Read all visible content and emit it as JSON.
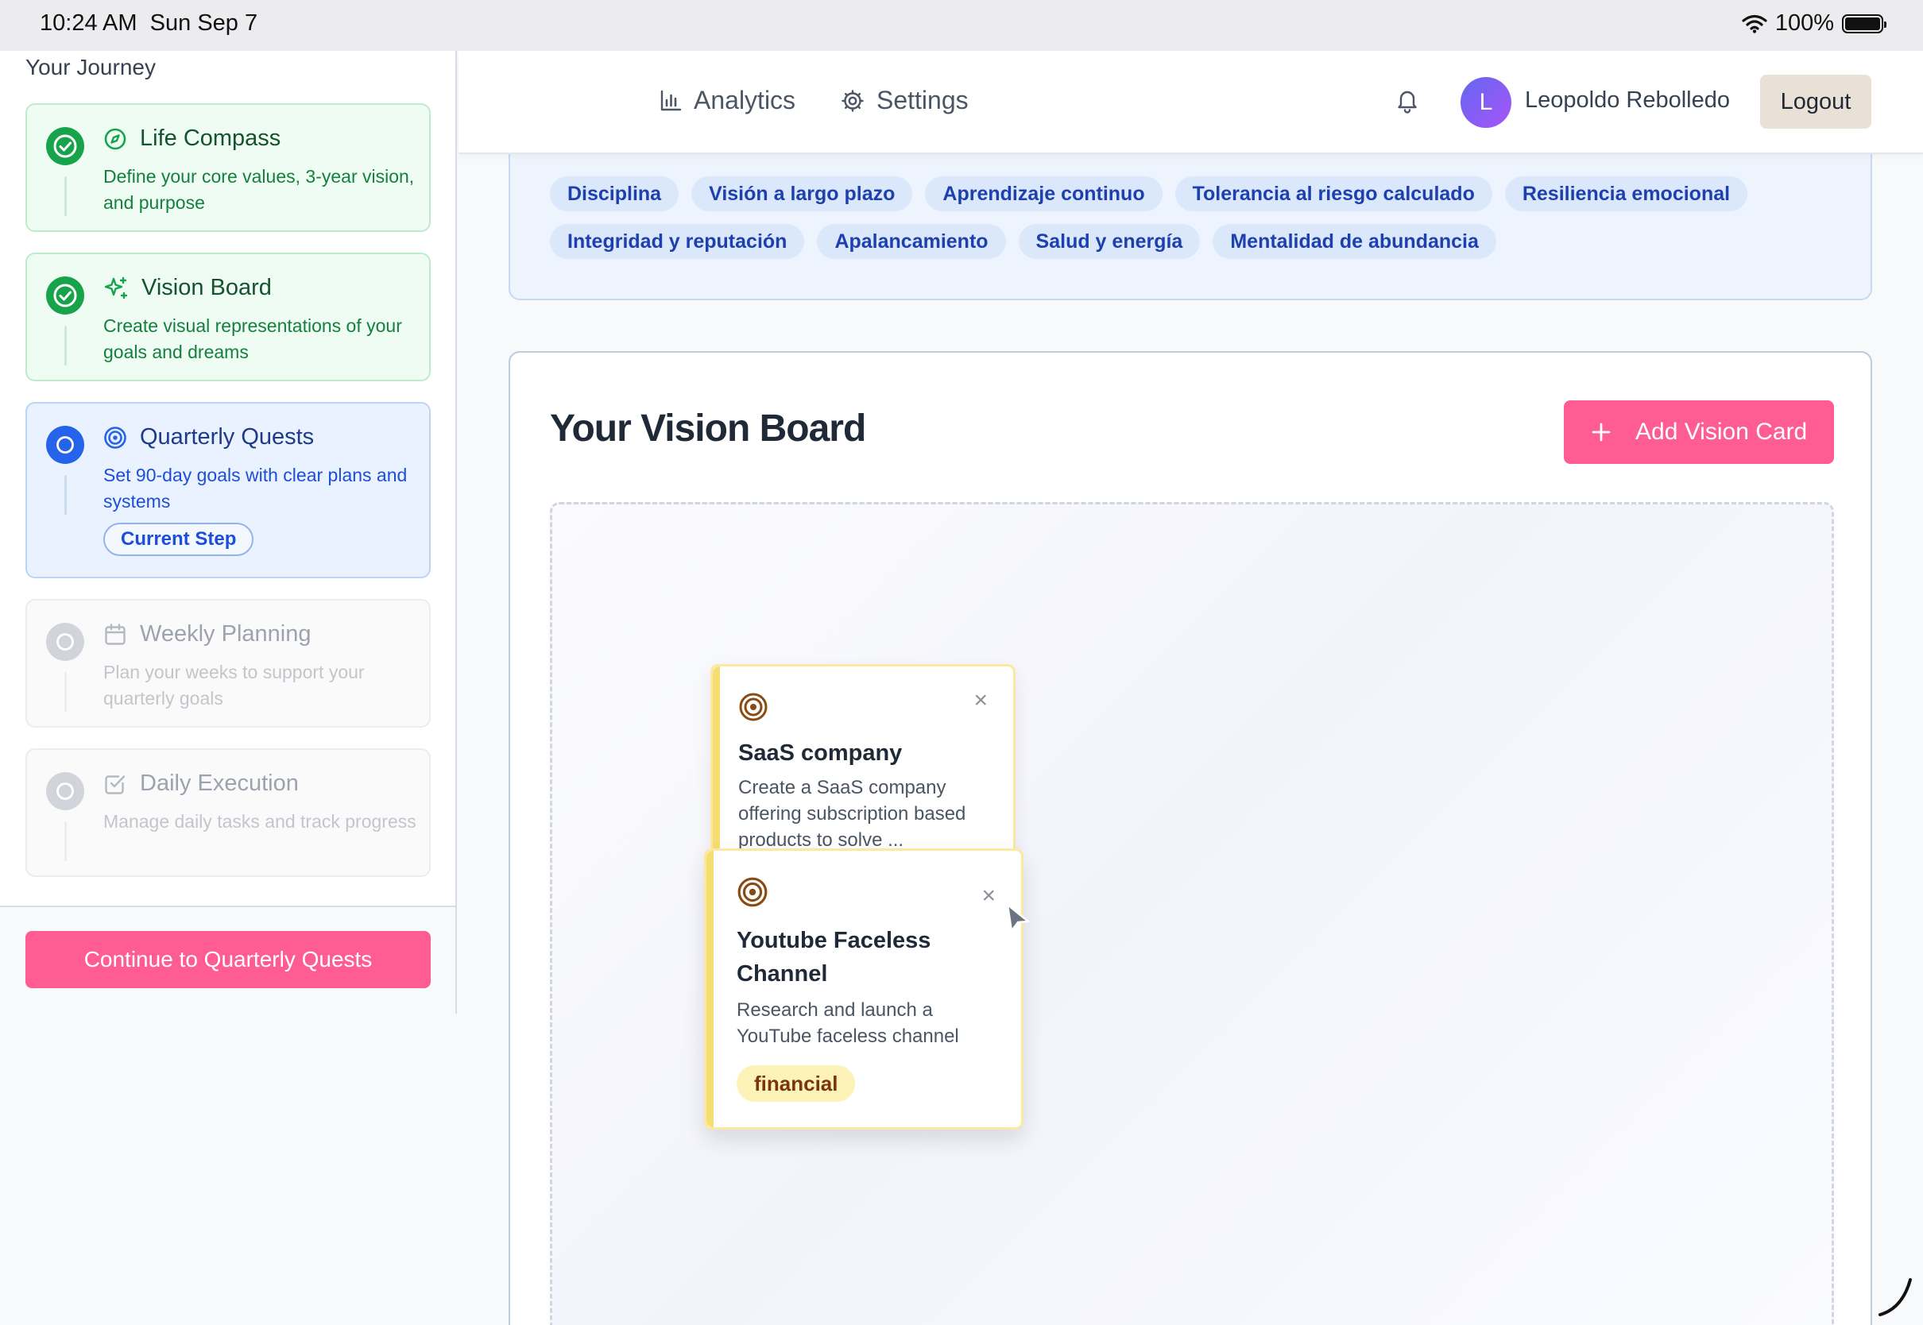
{
  "status_bar": {
    "time": "10:24 AM",
    "date": "Sun Sep 7",
    "battery": "100%"
  },
  "sidebar": {
    "title": "Your Journey",
    "steps": [
      {
        "title": "Life Compass",
        "desc": "Define your core values, 3-year vision, and purpose",
        "state": "completed",
        "icon": "compass-icon"
      },
      {
        "title": "Vision Board",
        "desc": "Create visual representations of your goals and dreams",
        "state": "completed",
        "icon": "sparkles-icon"
      },
      {
        "title": "Quarterly Quests",
        "desc": "Set 90-day goals with clear plans and systems",
        "state": "current",
        "icon": "target-icon",
        "badge": "Current Step"
      },
      {
        "title": "Weekly Planning",
        "desc": "Plan your weeks to support your quarterly goals",
        "state": "locked",
        "icon": "calendar-icon"
      },
      {
        "title": "Daily Execution",
        "desc": "Manage daily tasks and track progress",
        "state": "locked",
        "icon": "checkbox-icon"
      }
    ],
    "continue_label": "Continue to Quarterly Quests"
  },
  "topbar": {
    "nav": [
      {
        "label": "Analytics",
        "icon": "bar-chart-icon"
      },
      {
        "label": "Settings",
        "icon": "gear-icon"
      }
    ],
    "avatar_initial": "L",
    "user_name": "Leopoldo Rebolledo",
    "logout_label": "Logout"
  },
  "core_values": [
    "Disciplina",
    "Visión a largo plazo",
    "Aprendizaje continuo",
    "Tolerancia al riesgo calculado",
    "Resiliencia emocional",
    "Integridad y reputación",
    "Apalancamiento",
    "Salud y energía",
    "Mentalidad de abundancia"
  ],
  "vision_board": {
    "title": "Your Vision Board",
    "add_label": "Add Vision Card",
    "cards": [
      {
        "title": "SaaS company",
        "desc": "Create a SaaS company offering subscription based products to solve ...",
        "icon": "target-icon"
      },
      {
        "title": "Youtube Faceless Channel",
        "desc": "Research and launch a YouTube faceless channel",
        "tag": "financial",
        "icon": "target-icon"
      }
    ]
  },
  "colors": {
    "primary_pink": "#ff5c93",
    "done_green": "#16a34a",
    "current_blue": "#2563eb",
    "card_yellow": "#f6de72"
  }
}
